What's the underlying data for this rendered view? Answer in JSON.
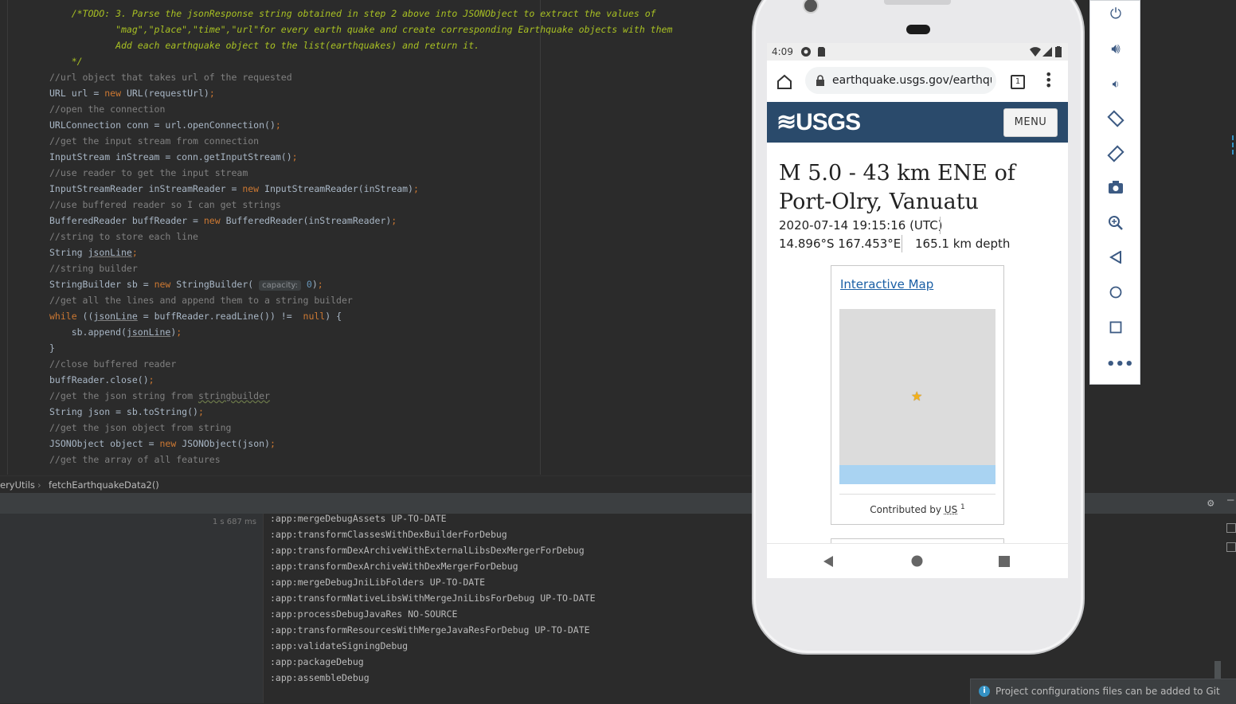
{
  "editor": {
    "lines": [
      {
        "cls": "todo",
        "text": "    /*TODO: 3. Parse the jsonResponse string obtained in step 2 above into JSONObject to extract the values of"
      },
      {
        "cls": "todo",
        "text": "            \"mag\",\"place\",\"time\",\"url\"for every earth quake and create corresponding Earthquake objects with them"
      },
      {
        "cls": "todo",
        "text": "            Add each earthquake object to the list(earthquakes) and return it."
      },
      {
        "cls": "todo",
        "text": "    */"
      },
      {
        "cls": "comment",
        "text": "//url object that takes url of the requested"
      },
      {
        "cls": "",
        "html": "URL url = <span class=\"kw\">new</span> URL(requestUrl)<span class=\"kw\">;</span>"
      },
      {
        "cls": "comment",
        "text": "//open the connection"
      },
      {
        "cls": "",
        "html": "URLConnection conn = url.openConnection()<span class=\"kw\">;</span>"
      },
      {
        "cls": "comment",
        "text": "//get the input stream from connection"
      },
      {
        "cls": "",
        "html": "InputStream inStream = conn.getInputStream()<span class=\"kw\">;</span>"
      },
      {
        "cls": "comment",
        "text": "//use reader to get the input stream"
      },
      {
        "cls": "",
        "html": "InputStreamReader inStreamReader = <span class=\"kw\">new</span> InputStreamReader(inStream)<span class=\"kw\">;</span>"
      },
      {
        "cls": "comment",
        "text": "//use buffered reader so I can get strings"
      },
      {
        "cls": "",
        "html": "BufferedReader buffReader = <span class=\"kw\">new</span> BufferedReader(inStreamReader)<span class=\"kw\">;</span>"
      },
      {
        "cls": "comment",
        "text": "//string to store each line"
      },
      {
        "cls": "",
        "html": "String <span class=\"u\">jsonLine</span><span class=\"kw\">;</span>"
      },
      {
        "cls": "comment",
        "text": "//string builder"
      },
      {
        "cls": "",
        "html": "StringBuilder sb = <span class=\"kw\">new</span> StringBuilder( <span class=\"hint\">capacity:</span> <span class=\"num\">0</span>)<span class=\"kw\">;</span>"
      },
      {
        "cls": "comment",
        "text": "//get all the lines and append them to a string builder"
      },
      {
        "cls": "",
        "html": "<span class=\"kw\">while</span> ((<span class=\"u\">jsonLine</span> = buffReader.readLine()) !=  <span class=\"kw\">null</span>) {"
      },
      {
        "cls": "",
        "html": "    sb.append(<span class=\"u\">jsonLine</span>)<span class=\"kw\">;</span>"
      },
      {
        "cls": "",
        "text": "}"
      },
      {
        "cls": "comment",
        "text": "//close buffered reader"
      },
      {
        "cls": "",
        "html": "buffReader.close()<span class=\"kw\">;</span>"
      },
      {
        "cls": "comment",
        "html": "//get the json string from <span class=\"squiggle\">stringbuilder</span>"
      },
      {
        "cls": "",
        "html": "String json = sb.toString()<span class=\"kw\">;</span>"
      },
      {
        "cls": "comment",
        "text": "//get the json object from string"
      },
      {
        "cls": "",
        "html": "JSONObject object = <span class=\"kw\">new</span> JSONObject(json)<span class=\"kw\">;</span>"
      },
      {
        "cls": "comment",
        "text": "//get the array of all features"
      }
    ]
  },
  "breadcrumb": {
    "file": "eryUtils",
    "method": "fetchEarthquakeData2()"
  },
  "build": {
    "time": "1 s 687 ms",
    "output": [
      ":app:mergeDebugAssets UP-TO-DATE",
      ":app:transformClassesWithDexBuilderForDebug",
      ":app:transformDexArchiveWithExternalLibsDexMergerForDebug",
      ":app:transformDexArchiveWithDexMergerForDebug",
      ":app:mergeDebugJniLibFolders UP-TO-DATE",
      ":app:transformNativeLibsWithMergeJniLibsForDebug UP-TO-DATE",
      ":app:processDebugJavaRes NO-SOURCE",
      ":app:transformResourcesWithMergeJavaResForDebug UP-TO-DATE",
      ":app:validateSigningDebug",
      ":app:packageDebug",
      ":app:assembleDebug"
    ]
  },
  "notification": {
    "text": "Project configurations files can be added to Git"
  },
  "phone": {
    "status_time": "4:09",
    "url": "earthquake.usgs.gov/earthquakes",
    "tab_count": "1",
    "logo": "≋USGS",
    "menu_label": "MENU",
    "title": "M 5.0 - 43 km ENE of Port-Olry, Vanuatu",
    "time": "2020-07-14 19:15:16 (UTC)",
    "coords": "14.896°S 167.453°E",
    "depth": "165.1 km depth",
    "map_link": "Interactive Map",
    "contributed_prefix": "Contributed by ",
    "contributed_by": "US",
    "contributed_sup": "1"
  },
  "toolbar": {
    "buttons": [
      "power-icon",
      "volume-up-icon",
      "volume-down-icon",
      "rotate-left-icon",
      "rotate-right-icon",
      "camera-icon",
      "zoom-icon",
      "back-icon",
      "home-icon",
      "overview-icon",
      "more-icon"
    ]
  }
}
